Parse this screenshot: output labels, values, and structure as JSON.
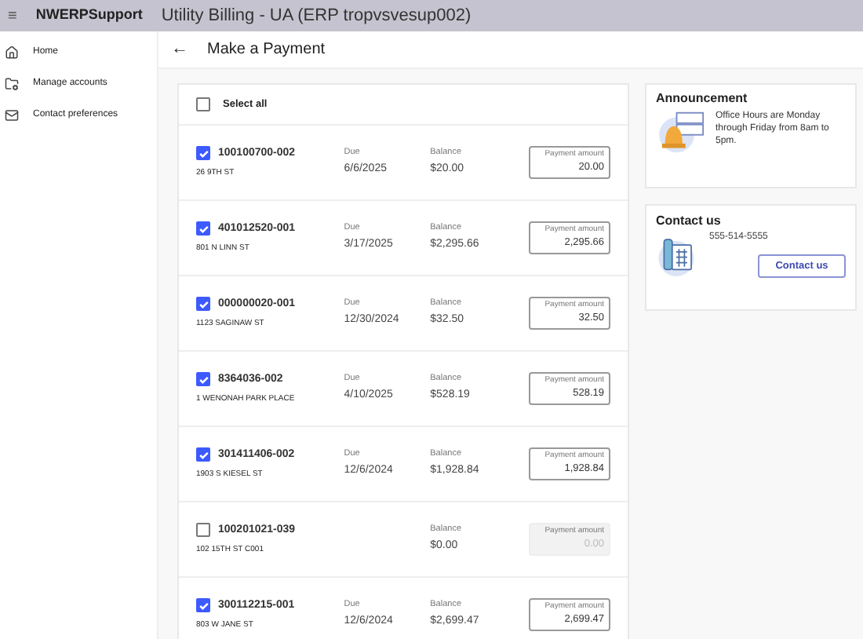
{
  "header": {
    "menu_icon": "≡",
    "app_name": "NWERPSupport",
    "title": "Utility Billing - UA (ERP tropvsvesup002)"
  },
  "sidebar": {
    "items": [
      {
        "label": "Home",
        "kind": "home"
      },
      {
        "label": "Manage accounts",
        "kind": "accounts"
      },
      {
        "label": "Contact preferences",
        "kind": "contact"
      }
    ]
  },
  "page": {
    "back": "←",
    "title": "Make a Payment"
  },
  "select_all": {
    "label": "Select all",
    "checked": false
  },
  "accounts": [
    {
      "account": "100100700-002",
      "address": "26 9TH ST",
      "due_label": "Due",
      "due": "6/6/2025",
      "balance_label": "Balance",
      "balance": "$20.00",
      "amount_label": "Payment amount",
      "amount": "20.00",
      "checked": true,
      "disabled": false
    },
    {
      "account": "401012520-001",
      "address": "801 N LINN ST",
      "due_label": "Due",
      "due": "3/17/2025",
      "balance_label": "Balance",
      "balance": "$2,295.66",
      "amount_label": "Payment amount",
      "amount": "2,295.66",
      "checked": true,
      "disabled": false
    },
    {
      "account": "000000020-001",
      "address": "1123 SAGINAW ST",
      "due_label": "Due",
      "due": "12/30/2024",
      "balance_label": "Balance",
      "balance": "$32.50",
      "amount_label": "Payment amount",
      "amount": "32.50",
      "checked": true,
      "disabled": false
    },
    {
      "account": "8364036-002",
      "address": "1 WENONAH PARK PLACE",
      "due_label": "Due",
      "due": "4/10/2025",
      "balance_label": "Balance",
      "balance": "$528.19",
      "amount_label": "Payment amount",
      "amount": "528.19",
      "checked": true,
      "disabled": false
    },
    {
      "account": "301411406-002",
      "address": "1903 S KIESEL ST",
      "due_label": "Due",
      "due": "12/6/2024",
      "balance_label": "Balance",
      "balance": "$1,928.84",
      "amount_label": "Payment amount",
      "amount": "1,928.84",
      "checked": true,
      "disabled": false
    },
    {
      "account": "100201021-039",
      "address": "102 15TH ST C001",
      "balance_label": "Balance",
      "balance": "$0.00",
      "amount_label": "Payment amount",
      "amount": "0.00",
      "checked": false,
      "disabled": true
    },
    {
      "account": "300112215-001",
      "address": "803 W JANE ST",
      "due_label": "Due",
      "due": "12/6/2024",
      "balance_label": "Balance",
      "balance": "$2,699.47",
      "amount_label": "Payment amount",
      "amount": "2,699.47",
      "checked": true,
      "disabled": false
    }
  ],
  "announcement": {
    "title": "Announcement",
    "text": "Office Hours are Monday through Friday from 8am to 5pm."
  },
  "contact": {
    "title": "Contact us",
    "phone": "555-514-5555",
    "button": "Contact us"
  }
}
